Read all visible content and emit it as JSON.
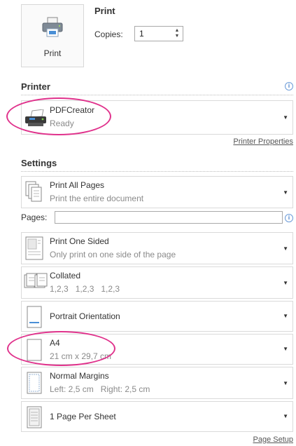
{
  "print_section": {
    "button_label": "Print",
    "title": "Print",
    "copies_label": "Copies:",
    "copies_value": "1"
  },
  "printer": {
    "header": "Printer",
    "name": "PDFCreator",
    "status": "Ready",
    "properties_link": "Printer Properties"
  },
  "settings": {
    "header": "Settings",
    "print_pages": {
      "title": "Print All Pages",
      "subtitle": "Print the entire document"
    },
    "pages_label": "Pages:",
    "pages_value": "",
    "sides": {
      "title": "Print One Sided",
      "subtitle": "Only print on one side of the page"
    },
    "collation": {
      "title": "Collated",
      "subtitle": "1,2,3   1,2,3   1,2,3"
    },
    "orientation": {
      "title": "Portrait Orientation"
    },
    "paper": {
      "title": "A4",
      "subtitle": "21 cm x 29,7 cm"
    },
    "margins": {
      "title": "Normal Margins",
      "subtitle": "Left: 2,5 cm   Right: 2,5 cm"
    },
    "pages_per_sheet": {
      "title": "1 Page Per Sheet"
    },
    "page_setup_link": "Page Setup"
  },
  "icons": {
    "printer": "printer-icon",
    "info": "info-icon",
    "dropdown": "dropdown-arrow-icon"
  },
  "colors": {
    "highlight_ellipse": "#e0328c",
    "info_blue": "#3a75c4"
  }
}
